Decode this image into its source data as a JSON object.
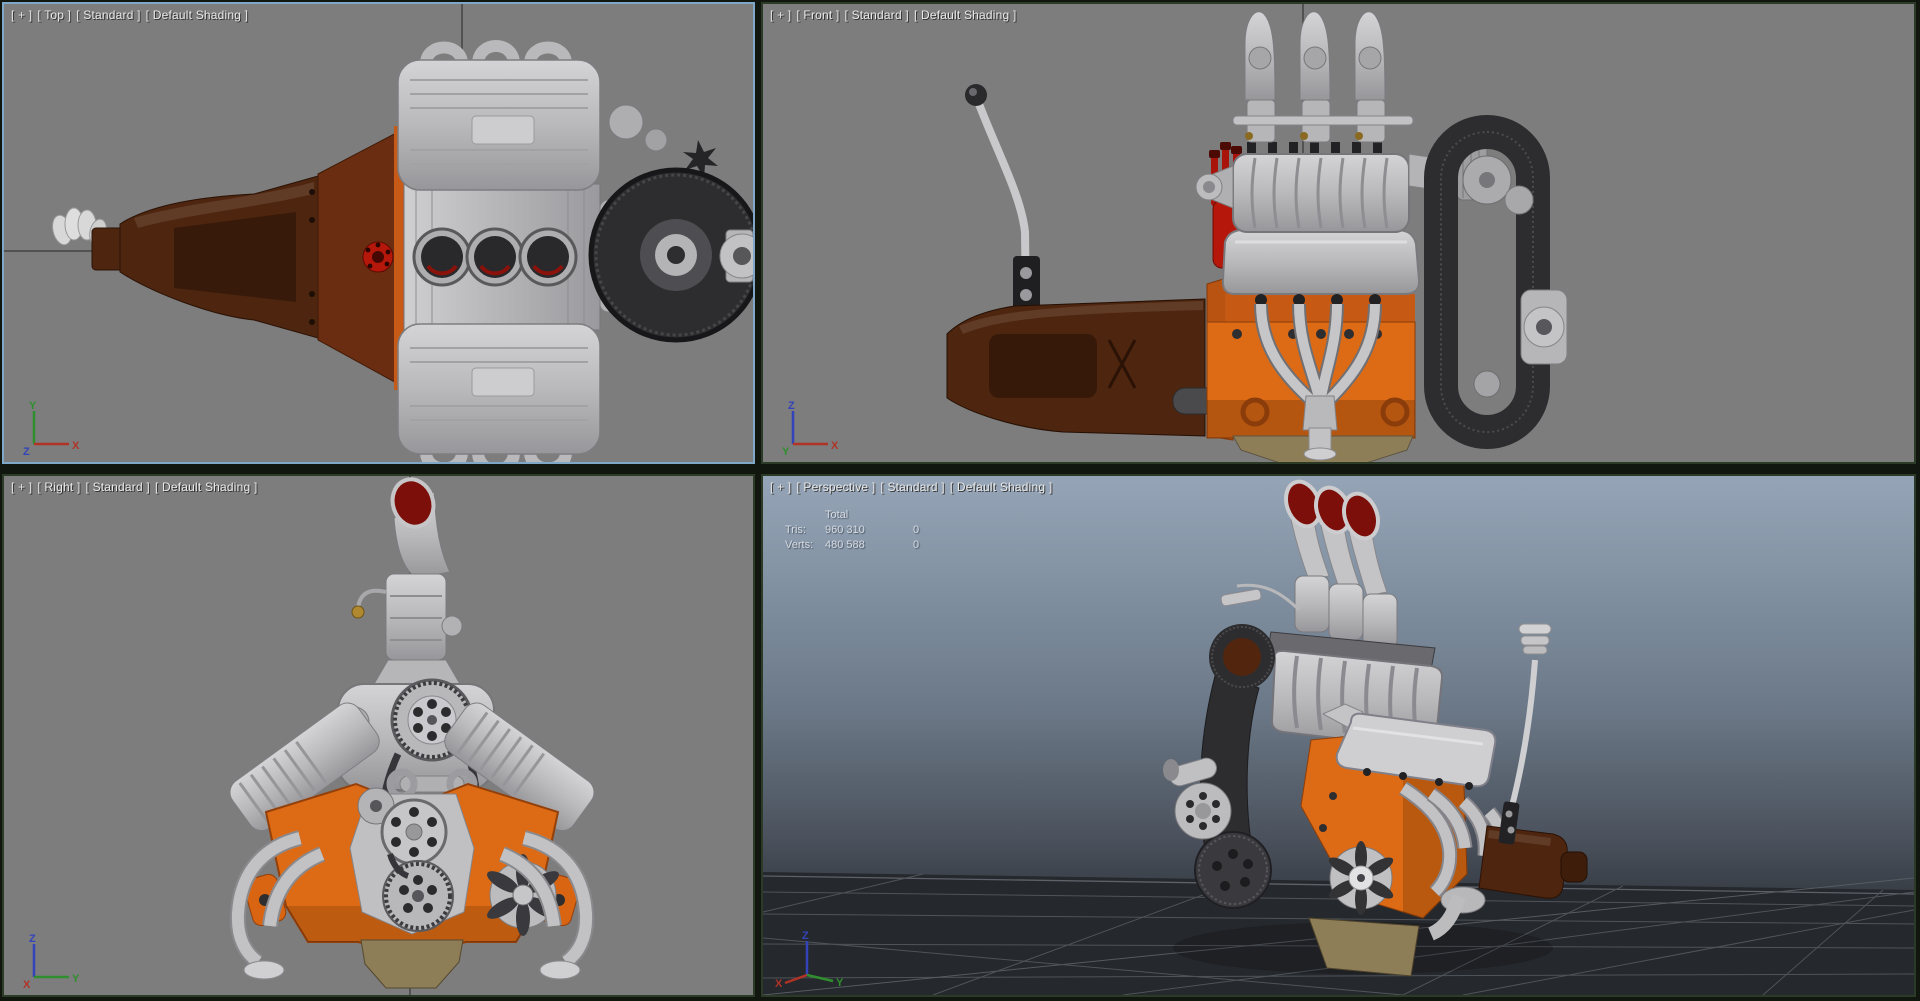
{
  "active_viewport": "top",
  "viewports": {
    "top": {
      "label": [
        "[ + ]",
        "[ Top ]",
        "[ Standard ]",
        "[ Default Shading ]"
      ],
      "axes": {
        "up": "Y",
        "right": "X",
        "origin": "Z"
      }
    },
    "front": {
      "label": [
        "[ + ]",
        "[ Front ]",
        "[ Standard ]",
        "[ Default Shading ]"
      ],
      "axes": {
        "up": "Z",
        "right": "X",
        "origin": "Y"
      }
    },
    "right": {
      "label": [
        "[ + ]",
        "[ Right ]",
        "[ Standard ]",
        "[ Default Shading ]"
      ],
      "axes": {
        "up": "Z",
        "right": "Y",
        "origin": "X"
      }
    },
    "perspective": {
      "label": [
        "[ + ]",
        "[ Perspective ]",
        "[ Standard ]",
        "[ Default Shading ]"
      ],
      "axes": {
        "up": "Z",
        "left": "X",
        "right": "Y"
      },
      "stats": {
        "header": "Total",
        "rows": [
          {
            "label": "Tris:",
            "total": "960 310",
            "selected": "0"
          },
          {
            "label": "Verts:",
            "total": "480 588",
            "selected": "0"
          }
        ]
      }
    }
  },
  "colors": {
    "active_viewport_border": "#7fa8c8",
    "inactive_viewport_border": "#2c3a28",
    "viewport_bg_gray": "#7d7d7d",
    "grid_axis_line": "#454545",
    "sky_top": "#95a5b7",
    "sky_bottom": "#222529",
    "engine_orange": "#dd6a14",
    "transmission_brown": "#4e250e",
    "belt_dark": "#2d2d2f",
    "oil_pan_tan": "#8d7e58",
    "stack_red": "#7c0f09",
    "distributor_red": "#b5170a",
    "silver": "#c4c4c6",
    "axis_x_red": "#b03326",
    "axis_y_green": "#2f8f2f",
    "axis_z_blue": "#3344bb"
  }
}
